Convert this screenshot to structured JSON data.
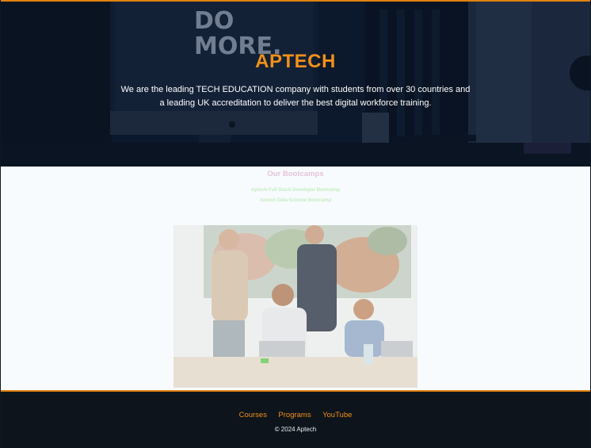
{
  "hero": {
    "title": "APTECH",
    "tagline": "We are the leading TECH EDUCATION company with students from over 30 countries and a leading UK accreditation to deliver the best digital workforce training.",
    "background_word": "DO MORE."
  },
  "bootcamps": {
    "title": "Our Bootcamps",
    "items": [
      "Aptech Full Stack Developer Bootcamp",
      "Aptech Data Science Bootcamp"
    ]
  },
  "footer": {
    "links": [
      "Courses",
      "Programs",
      "YouTube"
    ],
    "copyright": "© 2024 Aptech"
  },
  "colors": {
    "accent": "#f0901a",
    "hero_bg": "#0d1a2c",
    "footer_bg": "#0e141b",
    "page_bg": "#f7fbfe"
  }
}
